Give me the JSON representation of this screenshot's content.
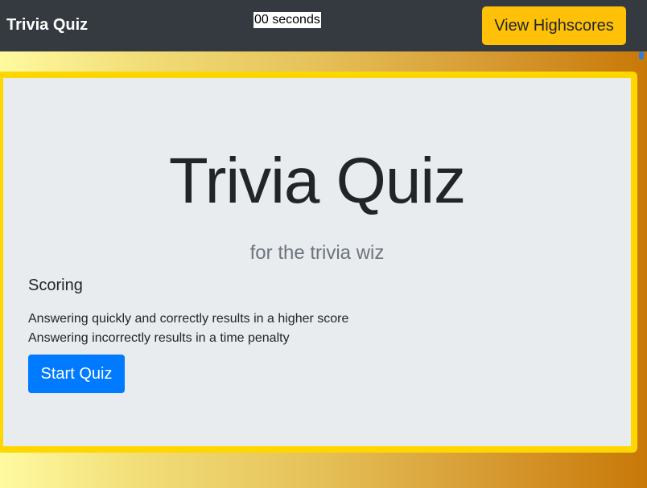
{
  "navbar": {
    "brand": "Trivia Quiz",
    "timer": "00 seconds",
    "highscores_label": "View Highscores"
  },
  "main": {
    "title": "Trivia Quiz",
    "subtitle": "for the trivia wiz",
    "scoring_heading": "Scoring",
    "rules": [
      "Answering quickly and correctly results in a higher score",
      "Answering incorrectly results in a time penalty"
    ],
    "start_label": "Start Quiz"
  },
  "colors": {
    "navbar_bg": "#343a40",
    "highscores_button": "#ffc107",
    "start_button": "#007bff",
    "jumbotron_bg": "#e9ecef",
    "jumbotron_border": "#ffd700",
    "subtitle_text": "#6c757d"
  }
}
